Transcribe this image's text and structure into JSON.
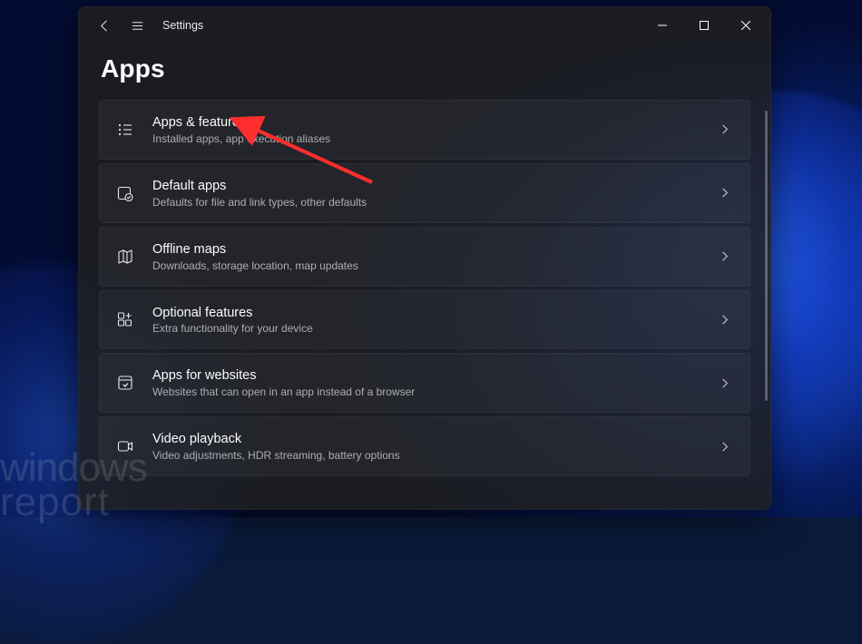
{
  "window": {
    "title": "Settings",
    "page_title": "Apps"
  },
  "items": [
    {
      "title": "Apps & features",
      "sub": "Installed apps, app execution aliases"
    },
    {
      "title": "Default apps",
      "sub": "Defaults for file and link types, other defaults"
    },
    {
      "title": "Offline maps",
      "sub": "Downloads, storage location, map updates"
    },
    {
      "title": "Optional features",
      "sub": "Extra functionality for your device"
    },
    {
      "title": "Apps for websites",
      "sub": "Websites that can open in an app instead of a browser"
    },
    {
      "title": "Video playback",
      "sub": "Video adjustments, HDR streaming, battery options"
    }
  ],
  "watermark": {
    "line1": "windows",
    "line2": "report"
  }
}
